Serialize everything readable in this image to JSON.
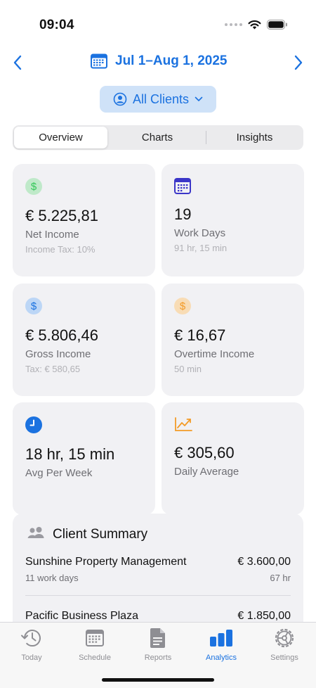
{
  "status": {
    "time": "09:04"
  },
  "header": {
    "date_range": "Jul 1–Aug 1, 2025",
    "prev_icon": "chevron-left-icon",
    "next_icon": "chevron-right-icon",
    "calendar_icon": "calendar-icon"
  },
  "client_filter": {
    "label": "All Clients",
    "icon": "person-circle-icon"
  },
  "segments": [
    {
      "label": "Overview",
      "active": true
    },
    {
      "label": "Charts",
      "active": false
    },
    {
      "label": "Insights",
      "active": false
    }
  ],
  "stats": {
    "net_income": {
      "value": "€ 5.225,81",
      "label": "Net Income",
      "sub": "Income Tax: 10%",
      "icon": "dollar-green-icon"
    },
    "work_days": {
      "value": "19",
      "label": "Work Days",
      "sub": "91 hr, 15 min",
      "icon": "calendar-icon"
    },
    "gross_income": {
      "value": "€ 5.806,46",
      "label": "Gross Income",
      "sub": "Tax: € 580,65",
      "icon": "dollar-blue-icon"
    },
    "overtime_income": {
      "value": "€ 16,67",
      "label": "Overtime Income",
      "sub": "50 min",
      "icon": "dollar-orange-icon"
    },
    "avg_week": {
      "value": "18 hr, 15 min",
      "label": "Avg Per Week",
      "icon": "clock-icon"
    },
    "daily_average": {
      "value": "€ 305,60",
      "label": "Daily Average",
      "icon": "trend-chart-icon"
    }
  },
  "client_summary": {
    "title": "Client Summary",
    "icon": "people-icon",
    "clients": [
      {
        "name": "Sunshine Property Management",
        "amount": "€ 3.600,00",
        "days": "11 work days",
        "hours": "67 hr"
      },
      {
        "name": "Pacific Business Plaza",
        "amount": "€ 1.850,00"
      }
    ]
  },
  "tabs": [
    {
      "label": "Today",
      "icon": "history-clock-icon",
      "active": false
    },
    {
      "label": "Schedule",
      "icon": "calendar-icon",
      "active": false
    },
    {
      "label": "Reports",
      "icon": "document-icon",
      "active": false
    },
    {
      "label": "Analytics",
      "icon": "bar-chart-icon",
      "active": true
    },
    {
      "label": "Settings",
      "icon": "gear-icon",
      "active": false
    }
  ],
  "colors": {
    "accent": "#1b72e0",
    "card_bg": "#f1f1f4",
    "green": "#34c759",
    "orange": "#f39b27",
    "pill_bg": "#cfe2f8"
  }
}
